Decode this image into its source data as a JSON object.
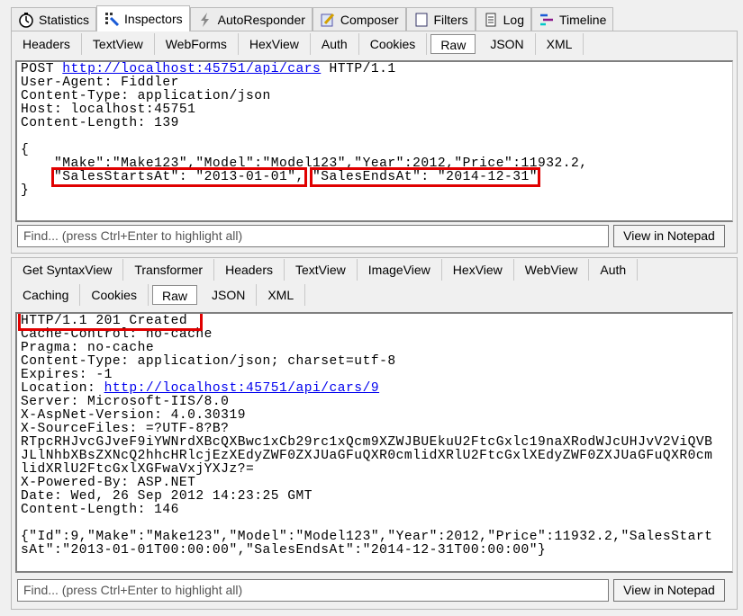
{
  "main_tabs": [
    {
      "label": "Statistics",
      "icon": "stopwatch-icon"
    },
    {
      "label": "Inspectors",
      "icon": "inspectors-icon",
      "active": true
    },
    {
      "label": "AutoResponder",
      "icon": "lightning-icon"
    },
    {
      "label": "Composer",
      "icon": "composer-icon"
    },
    {
      "label": "Filters",
      "icon": "filters-icon"
    },
    {
      "label": "Log",
      "icon": "log-icon"
    },
    {
      "label": "Timeline",
      "icon": "timeline-icon"
    }
  ],
  "request": {
    "tabs": [
      "Headers",
      "TextView",
      "WebForms",
      "HexView",
      "Auth",
      "Cookies",
      "Raw",
      "JSON",
      "XML"
    ],
    "active_tab": "Raw",
    "line1_method": "POST ",
    "line1_url": "http://localhost:45751/api/cars",
    "line1_proto": " HTTP/1.1",
    "headers": "User-Agent: Fiddler\nContent-Type: application/json\nHost: localhost:45751\nContent-Length: 139\n\n{",
    "body_line1": "    \"Make\":\"Make123\",\"Model\":\"Model123\",\"Year\":2012,\"Price\":11932.2,",
    "body_indent": "    ",
    "body_hl1": "\"SalesStartsAt\": \"2013-01-01\",",
    "body_hl2": "\"SalesEndsAt\": \"2014-12-31\"",
    "body_end": "}",
    "find_placeholder": "Find... (press Ctrl+Enter to highlight all)",
    "notepad_button": "View in Notepad"
  },
  "response": {
    "tabs_row1": [
      "Get SyntaxView",
      "Transformer",
      "Headers",
      "TextView",
      "ImageView",
      "HexView",
      "WebView",
      "Auth"
    ],
    "tabs_row2": [
      "Caching",
      "Cookies",
      "Raw",
      "JSON",
      "XML"
    ],
    "active_tab": "Raw",
    "status_line": "HTTP/1.1 201 Created",
    "headers_a": "Cache-Control: no-cache\nPragma: no-cache\nContent-Type: application/json; charset=utf-8\nExpires: -1\nLocation: ",
    "location_url": "http://localhost:45751/api/cars/9",
    "headers_b": "\nServer: Microsoft-IIS/8.0\nX-AspNet-Version: 4.0.30319\nX-SourceFiles: =?UTF-8?B?\nRTpcRHJvcGJveF9iYWNrdXBcQXBwc1xCb29rc1xQcm9XZWJBUEkuU2FtcGxlc19naXRodWJcUHJvV2ViQVB\nJLlNhbXBsZXNcQ2hhcHRlcjEzXEdyZWF0ZXJUaGFuQXR0cmlidXRlU2FtcGxlXEdyZWF0ZXJUaGFuQXR0cm\nlidXRlU2FtcGxlXGFwaVxjYXJz?=\nX-Powered-By: ASP.NET\nDate: Wed, 26 Sep 2012 14:23:25 GMT\nContent-Length: 146\n\n{\"Id\":9,\"Make\":\"Make123\",\"Model\":\"Model123\",\"Year\":2012,\"Price\":11932.2,\"SalesStart\nsAt\":\"2013-01-01T00:00:00\",\"SalesEndsAt\":\"2014-12-31T00:00:00\"}",
    "find_placeholder": "Find... (press Ctrl+Enter to highlight all)",
    "notepad_button": "View in Notepad"
  },
  "colors": {
    "highlight": "#e00000",
    "link": "#0000ee"
  }
}
